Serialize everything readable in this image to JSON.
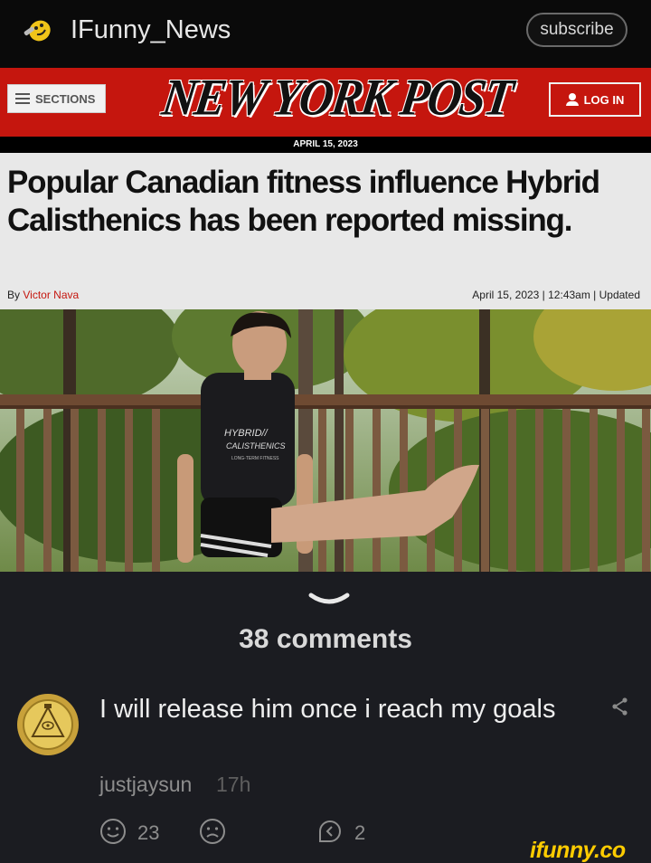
{
  "header": {
    "channel_name": "IFunny_News",
    "subscribe_label": "subscribe",
    "avatar_icon": "mascot-icon"
  },
  "nyp": {
    "sections_label": "SECTIONS",
    "logo_text": "NEW YORK POST",
    "login_label": "LOG IN",
    "date_banner": "APRIL 15, 2023",
    "brand_color": "#c5160e"
  },
  "article": {
    "headline": "Popular Canadian fitness influence Hybrid Calisthenics has been reported missing.",
    "byline_prefix": "By",
    "author": "Victor Nava",
    "timestamp": "April 15, 2023 | 12:43am | Updated"
  },
  "photo": {
    "shirt_line1": "HYBRID//",
    "shirt_line2": "CALISTHENICS",
    "shirt_line3": "LONG-TERM FITNESS"
  },
  "comments": {
    "count_label": "38 comments",
    "items": [
      {
        "text": "I will release him once i reach my goals",
        "author": "justjaysun",
        "time": "17h",
        "smiles": "23",
        "replies": "2",
        "avatar_icon": "bill-cipher-coin-icon"
      }
    ]
  },
  "footer": {
    "watermark": "ifunny.co"
  }
}
